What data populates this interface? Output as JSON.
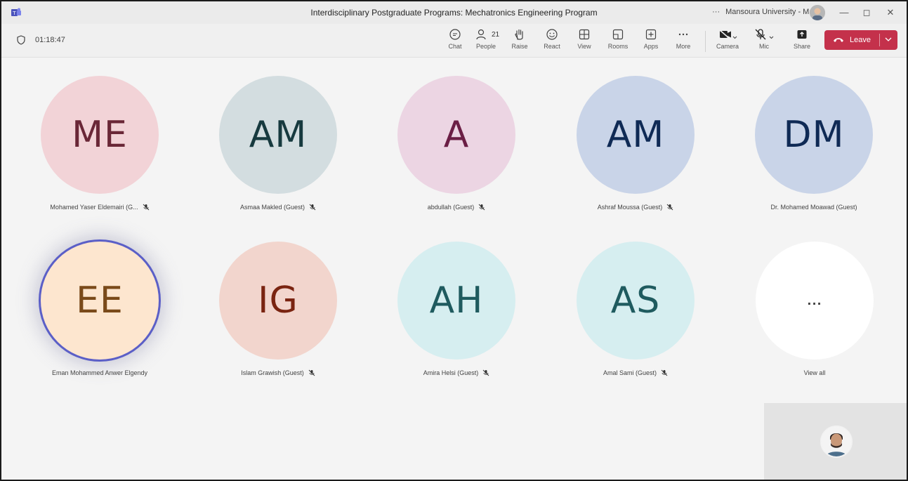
{
  "window": {
    "title": "Interdisciplinary Postgraduate Programs: Mechatronics Engineering Program",
    "org_dots": "···",
    "org": "Mansoura University - Main",
    "minimize": "—",
    "restore": "◻",
    "close": "✕"
  },
  "toolbar": {
    "timer": "01:18:47",
    "chat": "Chat",
    "people": "People",
    "people_count": "21",
    "raise": "Raise",
    "react": "React",
    "view": "View",
    "rooms": "Rooms",
    "apps": "Apps",
    "more": "More",
    "camera": "Camera",
    "mic": "Mic",
    "share": "Share",
    "leave": "Leave"
  },
  "participants": [
    {
      "initials": "ME",
      "name": "Mohamed Yaser Eldemairi (G...",
      "bg": "#f2d3d7",
      "fg": "#6a2737",
      "muted": true
    },
    {
      "initials": "AM",
      "name": "Asmaa Makled (Guest)",
      "bg": "#d3dde0",
      "fg": "#173a3f",
      "muted": true
    },
    {
      "initials": "A",
      "name": "abdullah (Guest)",
      "bg": "#ecd5e3",
      "fg": "#6b1e45",
      "muted": true
    },
    {
      "initials": "AM",
      "name": "Ashraf Moussa (Guest)",
      "bg": "#c9d4e8",
      "fg": "#0f2a55",
      "muted": true
    },
    {
      "initials": "DM",
      "name": "Dr. Mohamed Moawad (Guest)",
      "bg": "#c9d4e8",
      "fg": "#0f2a55",
      "muted": false
    },
    {
      "initials": "EE",
      "name": "Eman Mohammed Anwer Elgendy",
      "bg": "#fde6cf",
      "fg": "#7a4a1a",
      "muted": false
    },
    {
      "initials": "IG",
      "name": "Islam Grawish (Guest)",
      "bg": "#f2d5cd",
      "fg": "#7a2411",
      "muted": true
    },
    {
      "initials": "AH",
      "name": "Amira Helsi (Guest)",
      "bg": "#d6eef0",
      "fg": "#1f5b5f",
      "muted": true
    },
    {
      "initials": "AS",
      "name": "Amal Sami (Guest)",
      "bg": "#d6eef0",
      "fg": "#1f5b5f",
      "muted": true
    }
  ],
  "view_all": {
    "dots": "...",
    "label": "View all"
  },
  "colors": {
    "accent": "#5b5fc7",
    "leave": "#c4314b"
  }
}
